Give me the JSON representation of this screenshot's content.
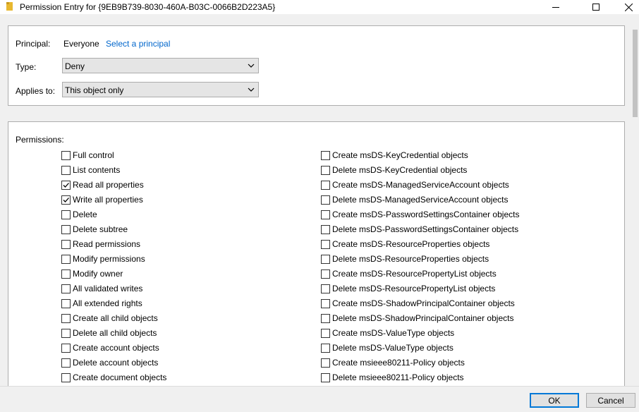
{
  "window": {
    "title": "Permission Entry for {9EB9B739-8030-460A-B03C-0066B2D223A5}"
  },
  "principal": {
    "label": "Principal:",
    "value": "Everyone",
    "link": "Select a principal"
  },
  "type": {
    "label": "Type:",
    "value": "Deny"
  },
  "applies_to": {
    "label": "Applies to:",
    "value": "This object only"
  },
  "permissions": {
    "label": "Permissions:",
    "left": [
      {
        "label": "Full control",
        "checked": false
      },
      {
        "label": "List contents",
        "checked": false
      },
      {
        "label": "Read all properties",
        "checked": true
      },
      {
        "label": "Write all properties",
        "checked": true
      },
      {
        "label": "Delete",
        "checked": false
      },
      {
        "label": "Delete subtree",
        "checked": false
      },
      {
        "label": "Read permissions",
        "checked": false
      },
      {
        "label": "Modify permissions",
        "checked": false
      },
      {
        "label": "Modify owner",
        "checked": false
      },
      {
        "label": "All validated writes",
        "checked": false
      },
      {
        "label": "All extended rights",
        "checked": false
      },
      {
        "label": "Create all child objects",
        "checked": false
      },
      {
        "label": "Delete all child objects",
        "checked": false
      },
      {
        "label": "Create account objects",
        "checked": false
      },
      {
        "label": "Delete account objects",
        "checked": false
      },
      {
        "label": "Create document objects",
        "checked": false
      }
    ],
    "right": [
      {
        "label": "Create msDS-KeyCredential objects",
        "checked": false
      },
      {
        "label": "Delete msDS-KeyCredential objects",
        "checked": false
      },
      {
        "label": "Create msDS-ManagedServiceAccount objects",
        "checked": false
      },
      {
        "label": "Delete msDS-ManagedServiceAccount objects",
        "checked": false
      },
      {
        "label": "Create msDS-PasswordSettingsContainer objects",
        "checked": false
      },
      {
        "label": "Delete msDS-PasswordSettingsContainer objects",
        "checked": false
      },
      {
        "label": "Create msDS-ResourceProperties objects",
        "checked": false
      },
      {
        "label": "Delete msDS-ResourceProperties objects",
        "checked": false
      },
      {
        "label": "Create msDS-ResourcePropertyList objects",
        "checked": false
      },
      {
        "label": "Delete msDS-ResourcePropertyList objects",
        "checked": false
      },
      {
        "label": "Create msDS-ShadowPrincipalContainer objects",
        "checked": false
      },
      {
        "label": "Delete msDS-ShadowPrincipalContainer objects",
        "checked": false
      },
      {
        "label": "Create msDS-ValueType objects",
        "checked": false
      },
      {
        "label": "Delete msDS-ValueType objects",
        "checked": false
      },
      {
        "label": "Create msieee80211-Policy objects",
        "checked": false
      },
      {
        "label": "Delete msieee80211-Policy objects",
        "checked": false
      }
    ]
  },
  "buttons": {
    "ok": "OK",
    "cancel": "Cancel"
  },
  "icons": {
    "title": "folder-icon",
    "minimize": "minimize-icon",
    "maximize": "maximize-icon",
    "close": "close-icon",
    "dropdown": "chevron-down-icon",
    "check": "checkmark-icon"
  },
  "colors": {
    "link": "#0066cc",
    "default_button_border": "#0078d7",
    "folder": "#e8b830"
  }
}
